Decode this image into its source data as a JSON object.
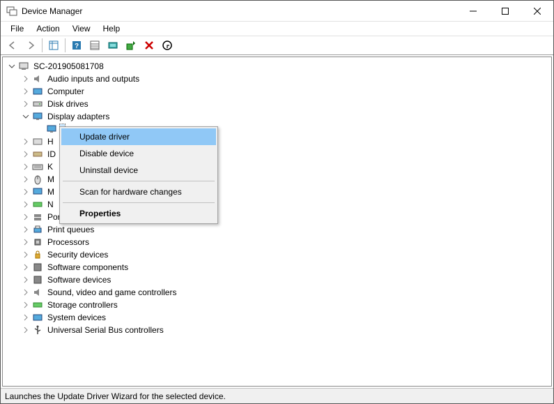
{
  "window": {
    "title": "Device Manager"
  },
  "menu": {
    "file": "File",
    "action": "Action",
    "view": "View",
    "help": "Help"
  },
  "tree": {
    "root": "SC-201905081708",
    "items": [
      "Audio inputs and outputs",
      "Computer",
      "Disk drives",
      "Display adapters",
      "H",
      "ID",
      "K",
      "M",
      "M",
      "N",
      "Ports (COM & LPT)",
      "Print queues",
      "Processors",
      "Security devices",
      "Software components",
      "Software devices",
      "Sound, video and game controllers",
      "Storage controllers",
      "System devices",
      "Universal Serial Bus controllers"
    ]
  },
  "context_menu": {
    "update": "Update driver",
    "disable": "Disable device",
    "uninstall": "Uninstall device",
    "scan": "Scan for hardware changes",
    "properties": "Properties"
  },
  "statusbar": {
    "text": "Launches the Update Driver Wizard for the selected device."
  }
}
